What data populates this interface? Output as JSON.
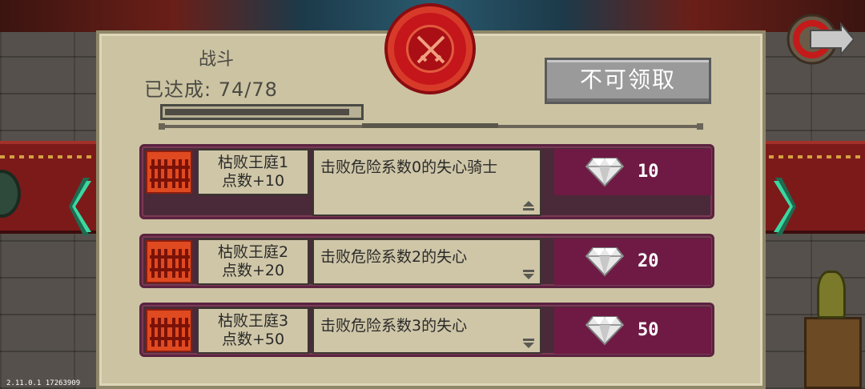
{
  "category_title": "战斗",
  "progress": {
    "label": "已达成:",
    "current": 74,
    "total": 78,
    "text": "74/78",
    "fraction": 0.949
  },
  "claim_button_label": "不可领取",
  "version": "2.11.0.1 17263909",
  "tasks": [
    {
      "name_line1": "枯败王庭1",
      "name_line2": "点数+10",
      "description": "击败危险系数0的失心骑士",
      "reward_amount": "10",
      "expanded": true
    },
    {
      "name_line1": "枯败王庭2",
      "name_line2": "点数+20",
      "description": "击败危险系数2的失心",
      "reward_amount": "20",
      "expanded": false
    },
    {
      "name_line1": "枯败王庭3",
      "name_line2": "点数+50",
      "description": "击败危险系数3的失心",
      "reward_amount": "50",
      "expanded": false
    }
  ],
  "icons": {
    "seal": "crossed-swords-seal-icon",
    "back": "back-arrow-icon",
    "nav_left": "chevron-left-icon",
    "nav_right": "chevron-right-icon",
    "reward": "diamond-icon",
    "task": "gate-icon"
  },
  "colors": {
    "panel": "#ccc3a2",
    "row_frame": "#4a2a38",
    "reward_bg": "#6e1a44",
    "task_icon": "#e04a20",
    "seal": "#c4161b",
    "arrow": "#3ad8a0"
  }
}
